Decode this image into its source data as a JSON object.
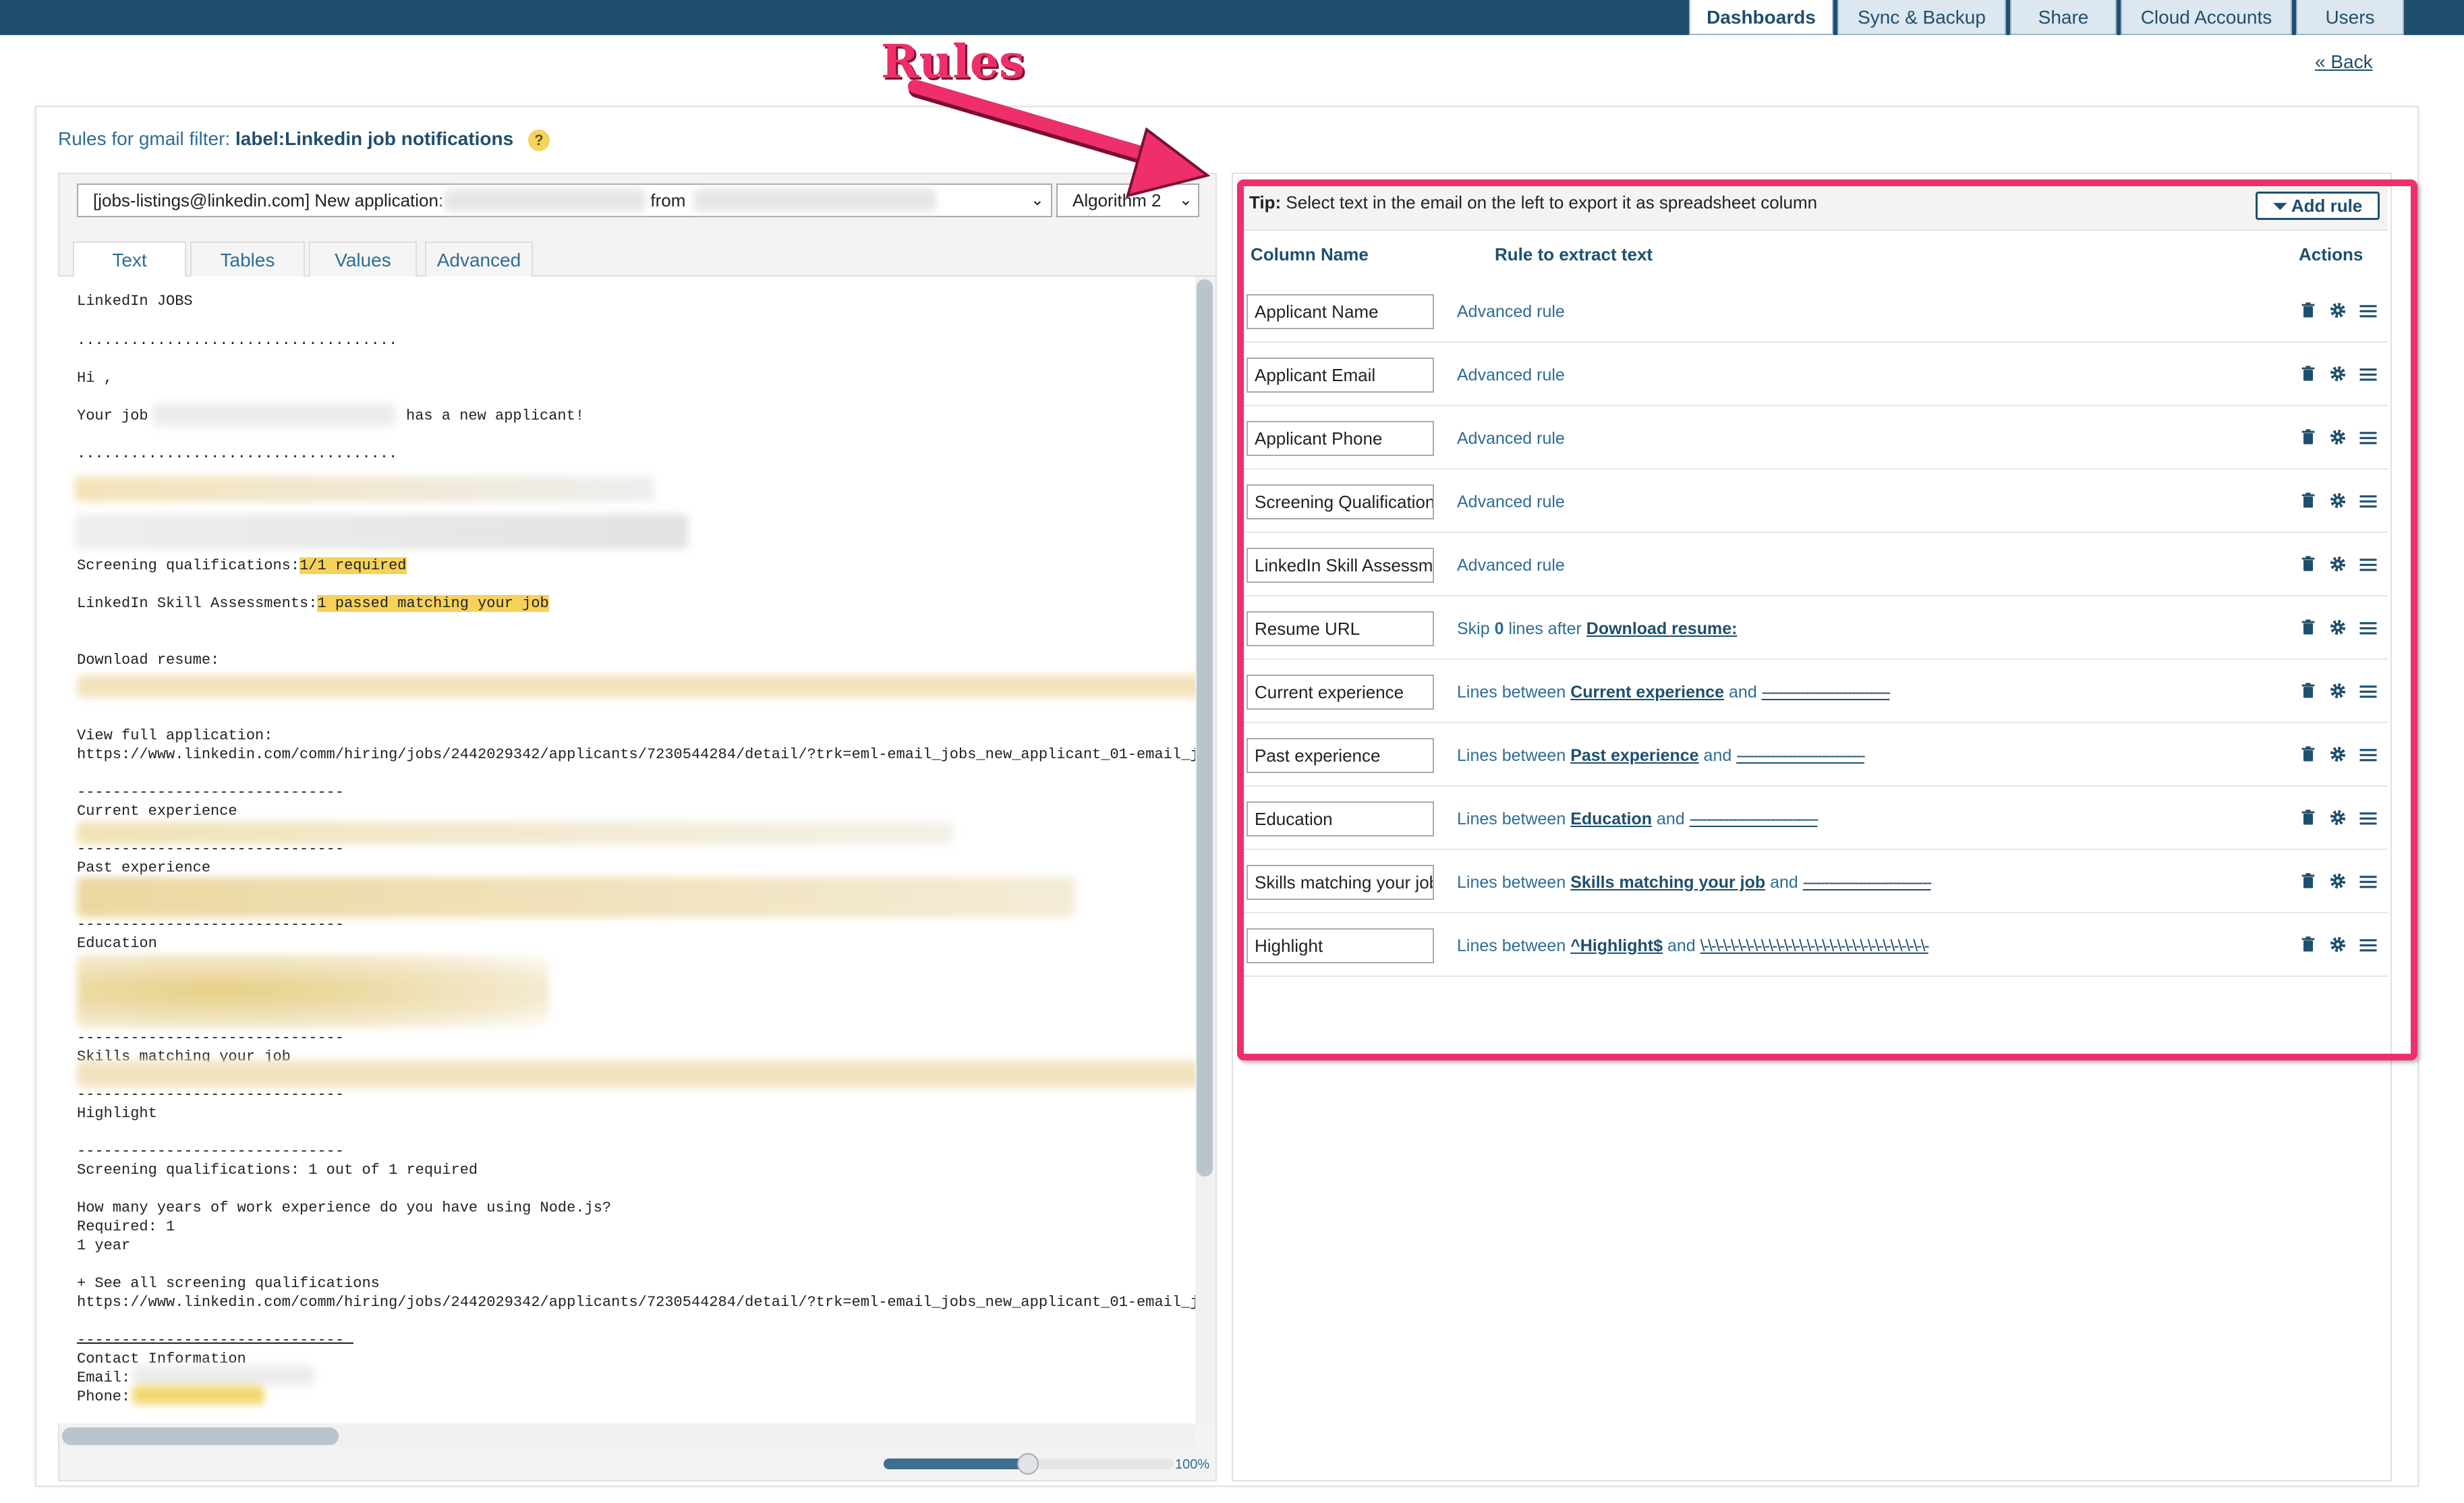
{
  "nav": {
    "tabs": [
      {
        "label": "Dashboards",
        "active": true
      },
      {
        "label": "Sync & Backup",
        "active": false
      },
      {
        "label": "Share",
        "active": false
      },
      {
        "label": "Cloud Accounts",
        "active": false
      },
      {
        "label": "Users",
        "active": false
      }
    ],
    "back_label": "« Back"
  },
  "annotation": {
    "label": "Rules",
    "color": "#ee2f6a"
  },
  "header": {
    "prefix": "Rules for gmail filter: ",
    "filter": "label:Linkedin job notifications",
    "help_icon": "help-icon"
  },
  "email_selector": {
    "value_prefix": "[jobs-listings@linkedin.com] New application: ",
    "value_mid": "from ",
    "algorithm": "Algorithm 2"
  },
  "subtabs": [
    "Text",
    "Tables",
    "Values",
    "Advanced"
  ],
  "email": {
    "lines": {
      "l1": "LinkedIn JOBS",
      "l2": "....................................",
      "l3": "Hi ,",
      "l4a": "Your job",
      "l4b": "has a new applicant!",
      "l5": "....................................",
      "sq_label": "Screening qualifications:",
      "sq_value": "1/1 required",
      "lsa_label": "LinkedIn Skill Assessments:",
      "lsa_value": "1 passed matching your job",
      "dl": "Download resume:",
      "vfa": "View full application:",
      "url1": "https://www.linkedin.com/comm/hiring/jobs/2442029342/applicants/7230544284/detail/?trk=eml-email_jobs_new_applicant_01-email_j",
      "sep1": "------------------------------",
      "cur": "Current experience",
      "sep2": "------------------------------",
      "past": "Past experience",
      "sep3": "------------------------------",
      "edu": "Education",
      "sep4": "------------------------------",
      "smy": "Skills matching your job",
      "sep5": "------------------------------",
      "hl": "Highlight",
      "sep6": "------------------------------",
      "sq2": "Screening qualifications: 1 out of 1 required",
      "q": "How many years of work experience do you have using Node.js?",
      "req": "Required: 1",
      "yr": "1 year",
      "see": "+ See all screening qualifications",
      "url2": "https://www.linkedin.com/comm/hiring/jobs/2442029342/applicants/7230544284/detail/?trk=eml-email_jobs_new_applicant_01-email_j",
      "sep7": "------------------------------",
      "ci": "Contact Information",
      "em": "Email:",
      "ph": "Phone:"
    }
  },
  "zoom": {
    "label": "100%",
    "level": 0.5
  },
  "rules_panel": {
    "tip_bold": "Tip:",
    "tip_text": " Select text in the email on the left to export it as spreadsheet column",
    "add_rule_label": "Add rule",
    "col_name": "Column Name",
    "col_rule": "Rule to extract text",
    "col_actions": "Actions",
    "rows": [
      {
        "name": "Applicant Name",
        "rule_plain": "Advanced rule"
      },
      {
        "name": "Applicant Email",
        "rule_plain": "Advanced rule"
      },
      {
        "name": "Applicant Phone",
        "rule_plain": "Advanced rule"
      },
      {
        "name": "Screening Qualifications",
        "rule_plain": "Advanced rule"
      },
      {
        "name": "LinkedIn Skill Assessments",
        "rule_plain": "Advanced rule"
      },
      {
        "name": "Resume URL",
        "rule_a": "Skip ",
        "rule_b": "0",
        "rule_c": " lines after ",
        "rule_d": "Download resume:"
      },
      {
        "name": "Current experience",
        "rule_a": "Lines between ",
        "rule_b": "Current experience",
        "rule_c": " and ",
        "rule_d": "------------------------------"
      },
      {
        "name": "Past experience",
        "rule_a": "Lines between ",
        "rule_b": "Past experience",
        "rule_c": " and ",
        "rule_d": "------------------------------"
      },
      {
        "name": "Education",
        "rule_a": "Lines between ",
        "rule_b": "Education",
        "rule_c": " and ",
        "rule_d": "------------------------------"
      },
      {
        "name": "Skills matching your job",
        "rule_a": "Lines between ",
        "rule_b": "Skills matching your job",
        "rule_c": " and ",
        "rule_d": "------------------------------"
      },
      {
        "name": "Highlight",
        "rule_a": "Lines between ",
        "rule_b": "^Highlight$",
        "rule_c": " and ",
        "rule_d": "\\-\\-\\-\\-\\-\\-\\-\\-\\-\\-\\-\\-\\-\\-\\-\\-\\-\\-\\-\\-\\-\\-\\-\\-\\-\\-\\-\\-\\-\\-"
      }
    ],
    "icons": [
      "trash-icon",
      "gear-icon",
      "drag-handle-icon"
    ]
  }
}
